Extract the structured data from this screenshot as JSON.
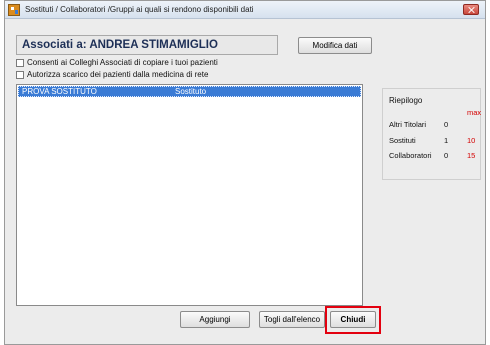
{
  "window": {
    "title": "Sostituti / Collaboratori /Gruppi ai quali si rendono disponibili dati"
  },
  "header": {
    "associati_text": "Associati a:  ANDREA STIMAMIGLIO",
    "modifica_label": "Modifica dati"
  },
  "options": [
    {
      "label": "Consenti ai Colleghi Associati di copiare i tuoi pazienti",
      "checked": false
    },
    {
      "label": "Autorizza scarico dei pazienti dalla medicina di rete",
      "checked": false
    }
  ],
  "list": {
    "rows": [
      {
        "name": "PROVA SOSTITUTO",
        "role": "Sostituto",
        "selected": true
      }
    ]
  },
  "summary": {
    "title": "Riepilogo",
    "max_label": "max",
    "rows": [
      {
        "label": "Altri Titolari",
        "count": "0",
        "max": ""
      },
      {
        "label": "Sostituti",
        "count": "1",
        "max": "10"
      },
      {
        "label": "Collaboratori",
        "count": "0",
        "max": "15"
      }
    ]
  },
  "buttons": {
    "aggiungi": "Aggiungi",
    "togli": "Togli dall'elenco",
    "chiudi": "Chiudi"
  },
  "colors": {
    "selection": "#3a7bd5",
    "highlight": "#e3000f",
    "max_text": "#d40000",
    "title_text": "#1d2f56"
  }
}
